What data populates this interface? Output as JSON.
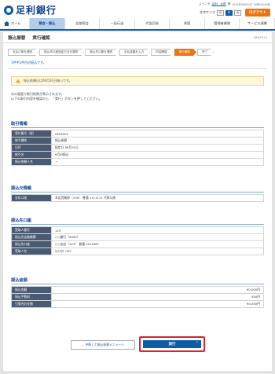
{
  "header": {
    "bank_name": "足利銀行",
    "user_prefix": "ようこそ",
    "user_name": "足利　太郎",
    "user_suffix": "様",
    "last_login": "20XX年06月24日 10時00分00秒",
    "font_label": "文字サイズ",
    "font_sizes": [
      "小",
      "中",
      "大"
    ],
    "logout_label": "ログアウト"
  },
  "nav": {
    "tabs": [
      {
        "label": "ホーム",
        "active": false
      },
      {
        "label": "照会・振込",
        "active": true
      },
      {
        "label": "全部照会",
        "active": false
      },
      {
        "label": "一括伝送",
        "active": false
      },
      {
        "label": "代金回収",
        "active": false
      },
      {
        "label": "承認",
        "active": false
      },
      {
        "label": "管理者業務",
        "active": false
      },
      {
        "label": "サービス連携",
        "active": false
      }
    ]
  },
  "page": {
    "title1": "振込振替",
    "title2": "実行確認",
    "screen_id": "BFKF013"
  },
  "steps": [
    "支払口座を選択",
    "振込先口座指定方法を選択",
    "振込先口座を選択",
    "支払金額を入力",
    "内容確認",
    "実行確認",
    "完了"
  ],
  "current_step": 5,
  "note": "1件中1件目の振込です。",
  "warning": "振込依頼日は06月31日扱いです。",
  "message1": "次の画面で取引結果が表示されます。",
  "message2": "以下の取引内容を確認の上、「実行」ボタンを押してください。",
  "sections": {
    "torihiki": {
      "title": "取引情報",
      "rows": [
        {
          "label": "受付番号（仮）",
          "value": "0424001"
        },
        {
          "label": "取引種別",
          "value": "振込振替"
        },
        {
          "label": "日付",
          "value": "指定日 06月31日"
        },
        {
          "label": "取引名",
          "value": "6月分振込"
        },
        {
          "label": "振込依頼人名",
          "value": "－"
        }
      ]
    },
    "moto": {
      "title": "振込元情報",
      "rows": [
        {
          "label": "支払口座",
          "value": "本店営業部（100） 普通 1111111 代表口座"
        }
      ]
    },
    "saki": {
      "title": "振込先口座",
      "rows": [
        {
          "label": "受取人番号",
          "value": "123"
        },
        {
          "label": "振込先金融機関",
          "value": "○○銀行（9999）"
        },
        {
          "label": "振込先口座",
          "value": "○○支店（123） 普通 1234567"
        },
        {
          "label": "受取人名",
          "value": "ｶ)ｱｼｶｶﾞｼﾖｳｼﾞ"
        }
      ]
    },
    "kingaku": {
      "title": "振込金額",
      "rows": [
        {
          "label": "振込金額",
          "value": "90,000円"
        },
        {
          "label": "振込手数料",
          "value": "550円"
        },
        {
          "label": "引落合計金額",
          "value": "90,550円"
        }
      ]
    }
  },
  "buttons": {
    "back": "中断して振込振替メニューへ",
    "execute": "実行"
  },
  "colors": {
    "brand": "#0a5ba8",
    "accent": "#e87511",
    "highlight": "#e0202a",
    "table_header": "#4a5a72"
  }
}
